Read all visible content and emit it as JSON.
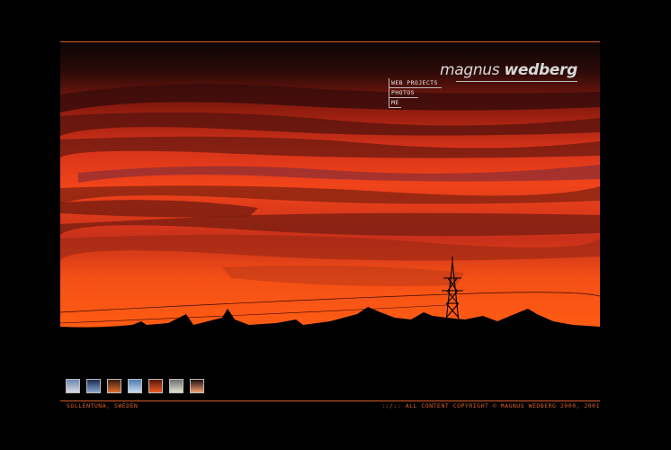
{
  "logo": {
    "first": "magnus",
    "last": "wedberg"
  },
  "menu": {
    "items": [
      "WEB PROJECTS",
      "PHOTOS",
      "ME"
    ]
  },
  "thumbnails": [
    {
      "label": "",
      "colors": [
        "#6c86b0",
        "#d9d9e6"
      ]
    },
    {
      "label": "",
      "colors": [
        "#1a2a50",
        "#8aa8d0"
      ]
    },
    {
      "label": "",
      "colors": [
        "#3a1c10",
        "#e07030"
      ]
    },
    {
      "label": "",
      "colors": [
        "#4c7db0",
        "#c8dcef"
      ]
    },
    {
      "label": "",
      "colors": [
        "#5a1808",
        "#f05a20"
      ]
    },
    {
      "label": "",
      "colors": [
        "#707070",
        "#e4e0d0"
      ]
    },
    {
      "label": "",
      "colors": [
        "#201010",
        "#f0a070"
      ]
    }
  ],
  "footer": {
    "location": "SOLLENTUNA, SWEDEN",
    "copyright_prefix": "::/::",
    "copyright": "ALL CONTENT COPYRIGHT © MAGNUS WEDBERG 2000, 2001"
  },
  "colors": {
    "accent": "#d9592a",
    "sky_top": "#1a0605",
    "sky_mid": "#e8401a",
    "sky_low": "#ff5a14",
    "ground": "#000000"
  }
}
